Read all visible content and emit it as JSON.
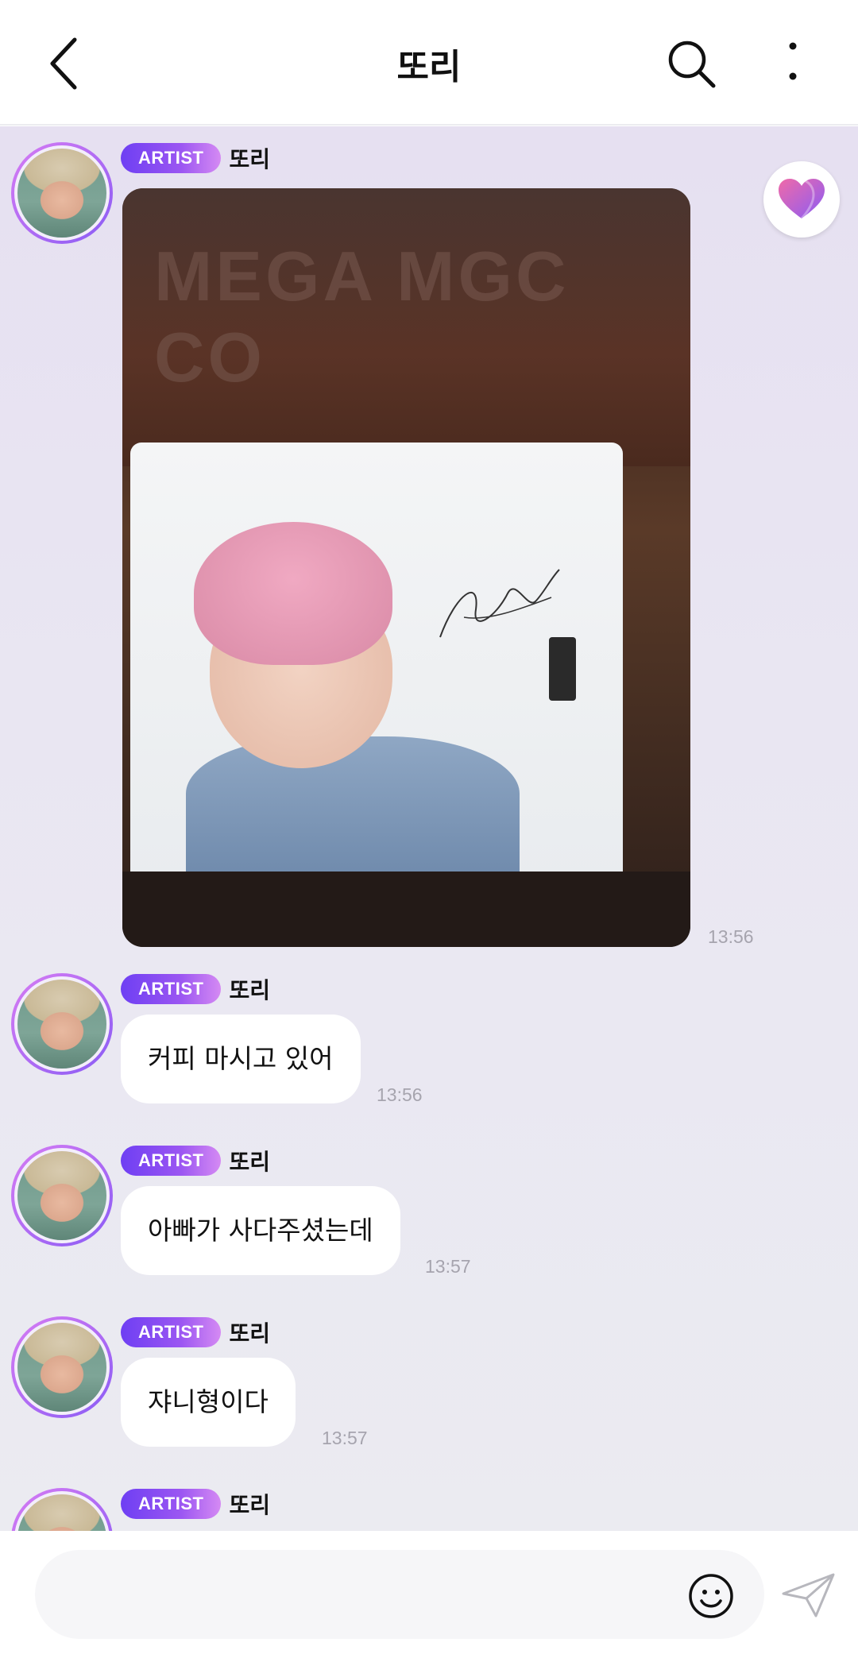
{
  "header": {
    "title": "또리"
  },
  "messages": [
    {
      "badge": "ARTIST",
      "name": "또리",
      "type": "image",
      "time": "13:56"
    },
    {
      "badge": "ARTIST",
      "name": "또리",
      "type": "text",
      "text": "커피 마시고 있어",
      "time": "13:56"
    },
    {
      "badge": "ARTIST",
      "name": "또리",
      "type": "text",
      "text": "아빠가 사다주셨는데",
      "time": "13:57"
    },
    {
      "badge": "ARTIST",
      "name": "또리",
      "type": "text",
      "text": "쟈니형이다",
      "time": "13:57"
    },
    {
      "badge": "ARTIST",
      "name": "또리",
      "type": "partial"
    }
  ],
  "photo": {
    "cup_text": "MEGA MGC CO"
  },
  "input": {
    "placeholder": ""
  },
  "icons": {
    "back": "chevron-left-icon",
    "search": "search-icon",
    "more": "more-vertical-icon",
    "heart": "heart-icon",
    "emoji": "smiley-icon",
    "send": "paper-plane-icon"
  },
  "colors": {
    "badge_start": "#6e3ff3",
    "badge_end": "#d58af3",
    "chat_bg": "#e8e4f1"
  }
}
